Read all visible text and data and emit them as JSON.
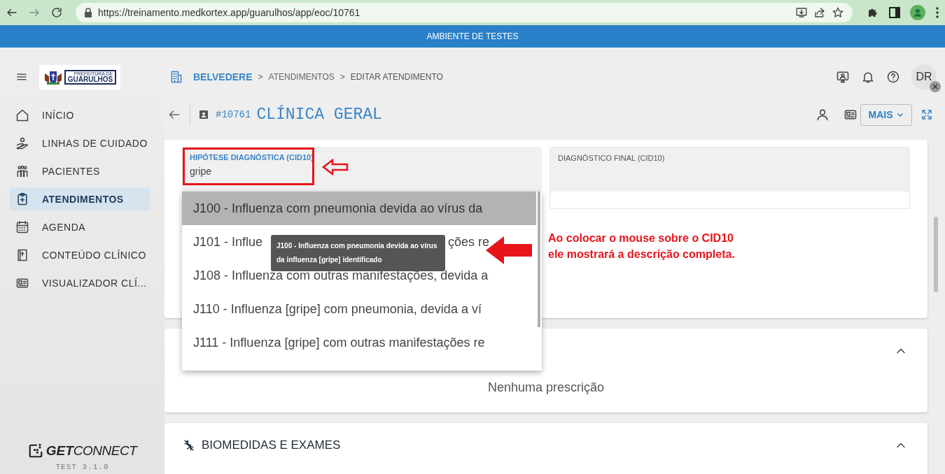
{
  "browser": {
    "url": "https://treinamento.medkortex.app/guarulhos/app/eoc/10761"
  },
  "banner": {
    "text": "AMBIENTE DE TESTES"
  },
  "logo": {
    "top": "PREFEITURA DE",
    "name": "GUARULHOS"
  },
  "sidebar": {
    "items": [
      {
        "label": "INÍCIO",
        "selected": false
      },
      {
        "label": "LINHAS DE CUIDADO",
        "selected": false
      },
      {
        "label": "PACIENTES",
        "selected": false
      },
      {
        "label": "ATENDIMENTOS",
        "selected": true
      },
      {
        "label": "AGENDA",
        "selected": false
      },
      {
        "label": "CONTEÚDO CLÍNICO",
        "selected": false
      },
      {
        "label": "VISUALIZADOR CLÍ...",
        "selected": false
      }
    ]
  },
  "footer": {
    "brand_bold": "GET",
    "brand_light": "CONNECT",
    "version": "TEST 3.1.0"
  },
  "breadcrumb": {
    "items": [
      "BELVEDERE",
      "ATENDIMENTOS",
      "EDITAR ATENDIMENTO"
    ],
    "separator": ">"
  },
  "avatar": {
    "initials": "DR"
  },
  "title": {
    "id": "#10761",
    "text": "CLÍNICA GERAL",
    "menu_button": "MAIS"
  },
  "fields": [
    {
      "label": "HIPÓTESE DIAGNÓSTICA (CID10)",
      "value": "gripe",
      "focused": true
    },
    {
      "label": "DIAGNÓSTICO FINAL (CID10)",
      "focused": false
    }
  ],
  "dropdown": {
    "options": [
      {
        "text": "J100 - Influenza com pneumonia devida ao vírus da",
        "selected": true
      },
      {
        "text": "J101 - Influe",
        "text_after": "ções re",
        "selected": false
      },
      {
        "text": "J108 - Influenza com outras manifestações, devida a",
        "selected": false
      },
      {
        "text": "J110 - Influenza [gripe] com pneumonia, devida a ví",
        "selected": false
      },
      {
        "text": "J111 - Influenza [gripe] com outras manifestações re",
        "selected": false
      }
    ]
  },
  "tooltip": {
    "text": "J100 - Influenza com pneumonia devida ao vírus da influenza [gripe] identificado"
  },
  "annotation": {
    "text": "Ao colocar o mouse sobre o CID10\nele mostrará a descrição completa."
  },
  "prescriptions": {
    "empty_text": "Nenhuma prescrição",
    "expanded": true
  },
  "biomeasures": {
    "title": "BIOMEDIDAS E EXAMES",
    "expanded": true
  }
}
